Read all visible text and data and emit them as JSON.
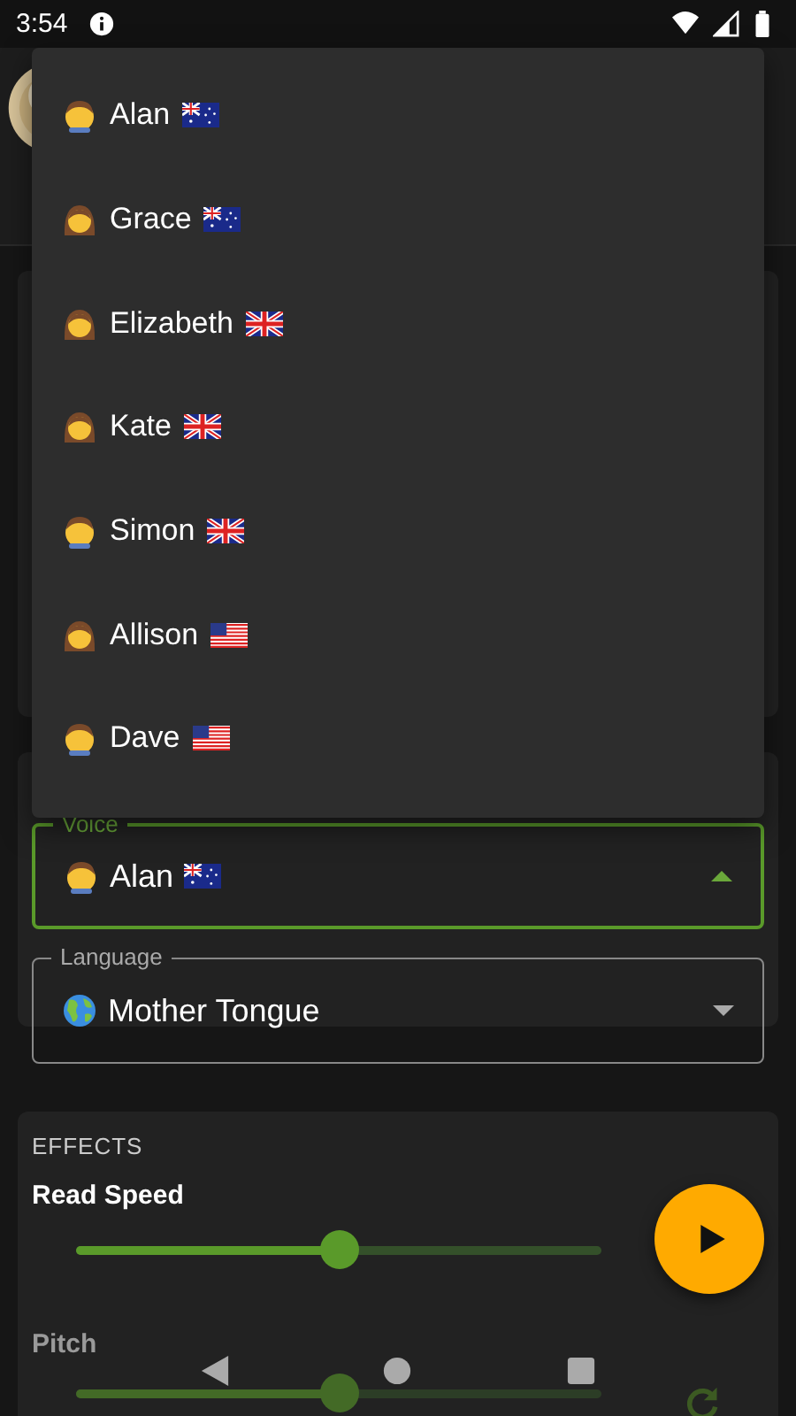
{
  "status_bar": {
    "time": "3:54"
  },
  "voice_menu": {
    "items": [
      {
        "name": "Alan",
        "person": {
          "kind": "man"
        },
        "flag": {
          "kind": "au"
        }
      },
      {
        "name": "Grace",
        "person": {
          "kind": "woman"
        },
        "flag": {
          "kind": "au"
        }
      },
      {
        "name": "Elizabeth",
        "person": {
          "kind": "woman"
        },
        "flag": {
          "kind": "gb"
        }
      },
      {
        "name": "Kate",
        "person": {
          "kind": "woman"
        },
        "flag": {
          "kind": "gb"
        }
      },
      {
        "name": "Simon",
        "person": {
          "kind": "man"
        },
        "flag": {
          "kind": "gb"
        }
      },
      {
        "name": "Allison",
        "person": {
          "kind": "woman"
        },
        "flag": {
          "kind": "us"
        }
      },
      {
        "name": "Dave",
        "person": {
          "kind": "man"
        },
        "flag": {
          "kind": "us"
        }
      }
    ]
  },
  "voice_field": {
    "label": "Voice",
    "value": "Alan",
    "person": {
      "kind": "man"
    },
    "flag": {
      "kind": "au"
    },
    "expanded": true
  },
  "language_field": {
    "label": "Language",
    "value": "Mother Tongue",
    "expanded": false
  },
  "effects": {
    "title": "EFFECTS",
    "sliders": [
      {
        "label": "Read Speed",
        "level": 0.5
      },
      {
        "label": "Pitch",
        "level": 0.5
      }
    ]
  }
}
